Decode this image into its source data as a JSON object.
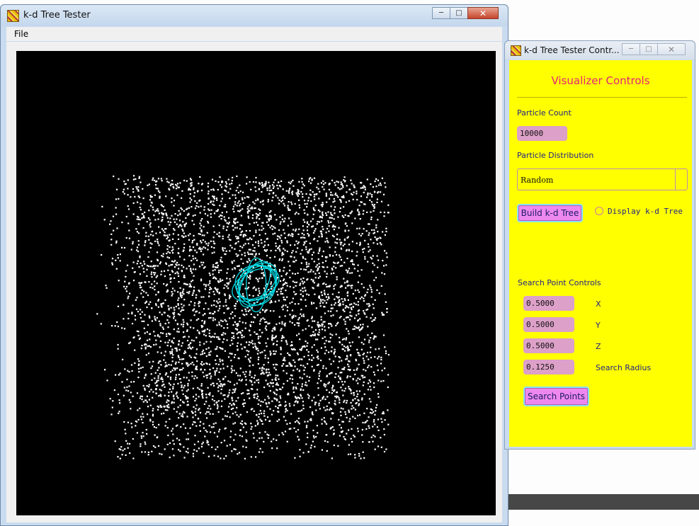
{
  "main_window": {
    "title": "k-d Tree Tester",
    "menu": {
      "file_label": "File"
    },
    "search_overlay_color": "#00d8e0",
    "point_color": "#ffffff"
  },
  "controls_window": {
    "title": "k-d Tree Tester Contr...",
    "panel_background": "#ffff00",
    "heading": "Visualizer Controls",
    "particle_count_label": "Particle Count",
    "particle_count_value": "10000",
    "distribution_label": "Particle Distribution",
    "distribution_value": "Random",
    "build_button_label": "Build k-d Tree",
    "display_tree_label": "Display k-d Tree",
    "display_tree_checked": false,
    "search_controls_label": "Search Point Controls",
    "x_label": "X",
    "x_value": "0.5000",
    "y_label": "Y",
    "y_value": "0.5000",
    "z_label": "Z",
    "z_value": "0.5000",
    "radius_label": "Search Radius",
    "radius_value": "0.1250",
    "search_button_label": "Search Points"
  },
  "caption_icons": {
    "minimize": "minimize-icon",
    "maximize": "maximize-icon",
    "close": "close-icon"
  }
}
